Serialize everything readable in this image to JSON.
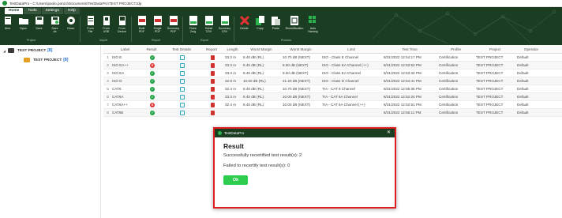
{
  "window": {
    "title": "TestDataPro - C:\\Users\\paolo.ponzo\\Documents\\TestDataPro\\TEST PROJECT.tdp"
  },
  "ribbon": {
    "tabs": [
      {
        "label": "Home",
        "active": true
      },
      {
        "label": "Tools",
        "active": false
      },
      {
        "label": "Settings",
        "active": false
      },
      {
        "label": "Help",
        "active": false
      }
    ],
    "buttons": [
      {
        "label": "New",
        "icon": "new-doc-icon"
      },
      {
        "label": "Open",
        "icon": "open-folder-icon"
      },
      {
        "label": "Save",
        "icon": "save-icon"
      },
      {
        "label": "Save\nAs",
        "icon": "save-as-icon"
      },
      {
        "label": "Close",
        "icon": "close-doc-icon"
      },
      {
        "label": "From\nFile",
        "icon": "import-file-icon"
      },
      {
        "label": "From\nUSB",
        "icon": "import-usb-icon"
      },
      {
        "label": "From\nDevice",
        "icon": "import-device-icon"
      },
      {
        "label": "Multi\nPDF",
        "icon": "pdf-multi-icon"
      },
      {
        "label": "Single\nPDF",
        "icon": "pdf-single-icon"
      },
      {
        "label": "Summary\nPDF",
        "icon": "pdf-summary-icon"
      },
      {
        "label": "Fluke\nZmg",
        "icon": "export-zmg-icon"
      },
      {
        "label": "Detail\nCSV",
        "icon": "csv-detail-icon"
      },
      {
        "label": "Summary\nCSV",
        "icon": "csv-summary-icon"
      },
      {
        "label": "Delete",
        "icon": "delete-icon"
      },
      {
        "label": "Copy",
        "icon": "copy-icon"
      },
      {
        "label": "Paste",
        "icon": "paste-icon"
      },
      {
        "label": "Recertification",
        "icon": "recertify-icon"
      },
      {
        "label": "Auto\nNaming",
        "icon": "auto-naming-icon"
      }
    ],
    "groups": [
      {
        "label": "Project"
      },
      {
        "label": "Import"
      },
      {
        "label": "Report"
      },
      {
        "label": "Export"
      },
      {
        "label": "Process"
      }
    ]
  },
  "tree": {
    "items": [
      {
        "label": "TEST PROJECT",
        "count": "[8]"
      },
      {
        "label": "TEST PROJECT",
        "count": "[8]"
      }
    ]
  },
  "grid": {
    "headers": [
      "",
      "Label",
      "Result",
      "Test Details",
      "Report",
      "Length",
      "Worst Margin",
      "Worst Margin",
      "Limit",
      "Test Time",
      "Profile",
      "Project",
      "Operator"
    ],
    "rows": [
      {
        "idx": "1",
        "label": "ISO E",
        "result": "pass",
        "length": "33.3 m",
        "wm": "8.40 dB (RL)",
        "wmar": "10.70 dB (NEXT)",
        "limit": "ISO - Class E Channel",
        "time": "8/31/2022 12:54:17 PM",
        "profile": "Certification",
        "project": "TEST PROJECT",
        "operator": "Default"
      },
      {
        "idx": "2",
        "label": "ISO EA++",
        "result": "fail",
        "length": "33.3 m",
        "wm": "8.40 dB (RL)",
        "wmar": "8.60 dB (NEXT)",
        "limit": "ISO - Class EA Channel (++)",
        "time": "8/31/2022 12:53:52 PM",
        "profile": "Certification",
        "project": "TEST PROJECT",
        "operator": "Default"
      },
      {
        "idx": "3",
        "label": "ISO EA",
        "result": "pass",
        "length": "33.3 m",
        "wm": "8.40 dB (RL)",
        "wmar": "8.60 dB (NEXT)",
        "limit": "ISO - Class EA Channel",
        "time": "8/31/2022 12:53:34 PM",
        "profile": "Certification",
        "project": "TEST PROJECT",
        "operator": "Default"
      },
      {
        "idx": "4",
        "label": "ISO D",
        "result": "pass",
        "length": "32.8 m",
        "wm": "10.60 dB (RL)",
        "wmar": "21.20 dB (NEXT)",
        "limit": "ISO - Class D Channel",
        "time": "8/31/2022 12:54:41 PM",
        "profile": "Certification",
        "project": "TEST PROJECT",
        "operator": "Default"
      },
      {
        "idx": "5",
        "label": "CAT6",
        "result": "pass",
        "length": "32.4 m",
        "wm": "8.40 dB (RL)",
        "wmar": "10.70 dB (NEXT)",
        "limit": "TIA - CAT 6 Channel",
        "time": "8/31/2022 12:55:35 PM",
        "profile": "Certification",
        "project": "TEST PROJECT",
        "operator": "Default"
      },
      {
        "idx": "6",
        "label": "CAT6A",
        "result": "pass",
        "length": "33.3 m",
        "wm": "8.40 dB (RL)",
        "wmar": "10.00 dB (NEXT)",
        "limit": "TIA - CAT 6A Channel",
        "time": "8/31/2022 12:52:24 PM",
        "profile": "Certification",
        "project": "TEST PROJECT",
        "operator": "Default"
      },
      {
        "idx": "7",
        "label": "CAT6A++",
        "result": "fail",
        "length": "32.4 m",
        "wm": "8.40 dB (RL)",
        "wmar": "10.00 dB (NEXT)",
        "limit": "TIA - CAT 6A Channel (++)",
        "time": "8/31/2022 12:52:51 PM",
        "profile": "Certification",
        "project": "TEST PROJECT",
        "operator": "Default"
      },
      {
        "idx": "8",
        "label": "CAT5E",
        "result": "pass",
        "length": "",
        "wm": "",
        "wmar": "",
        "limit": "",
        "time": "8/31/2022 12:55:11 PM",
        "profile": "Certification",
        "project": "TEST PROJECT",
        "operator": "Default"
      }
    ]
  },
  "dialog": {
    "window_title": "TestDataPro",
    "close_glyph": "✕",
    "heading": "Result",
    "success_line": "Successfully recertified test result(s): 2",
    "failed_line": "Failed to recertify test result(s): 0",
    "ok_label": "Ok"
  },
  "colors": {
    "ribbon_bg": "#1b3e23",
    "pass": "#22a345",
    "fail": "#e23333",
    "ok_button": "#2ecc4f",
    "dialog_border": "#e02020"
  }
}
